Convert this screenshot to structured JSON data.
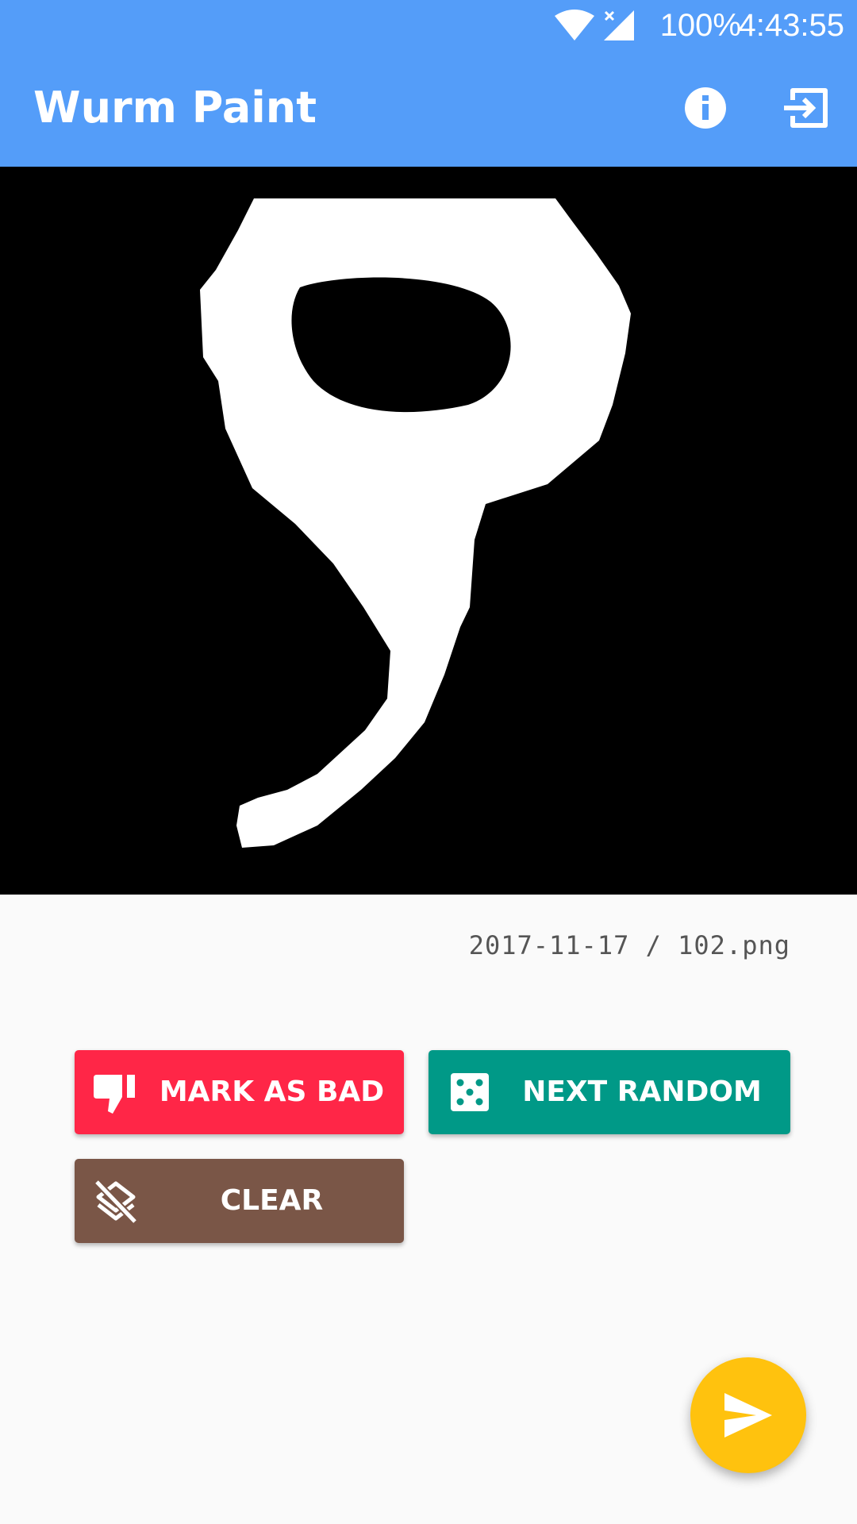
{
  "status_bar": {
    "battery": "100%",
    "time": "4:43:55",
    "icons": [
      "wifi-icon",
      "signal-off-icon"
    ]
  },
  "toolbar": {
    "title": "Wurm Paint",
    "actions": [
      "info-icon",
      "exit-icon"
    ]
  },
  "drawing": {
    "background": "#000000",
    "stroke_color": "#ffffff"
  },
  "file": {
    "label": "2017-11-17 / 102.png"
  },
  "buttons": {
    "mark_bad": {
      "label": "MARK AS BAD",
      "icon": "thumb-down-icon",
      "color": "#ff2647"
    },
    "next_random": {
      "label": "NEXT RANDOM",
      "icon": "dice-icon",
      "color": "#009987"
    },
    "clear": {
      "label": "CLEAR",
      "icon": "layers-clear-icon",
      "color": "#7a5647"
    }
  },
  "fab": {
    "icon": "send-icon",
    "color": "#ffc20e"
  },
  "colors": {
    "app_bar": "#549df9",
    "background": "#fafafa"
  }
}
